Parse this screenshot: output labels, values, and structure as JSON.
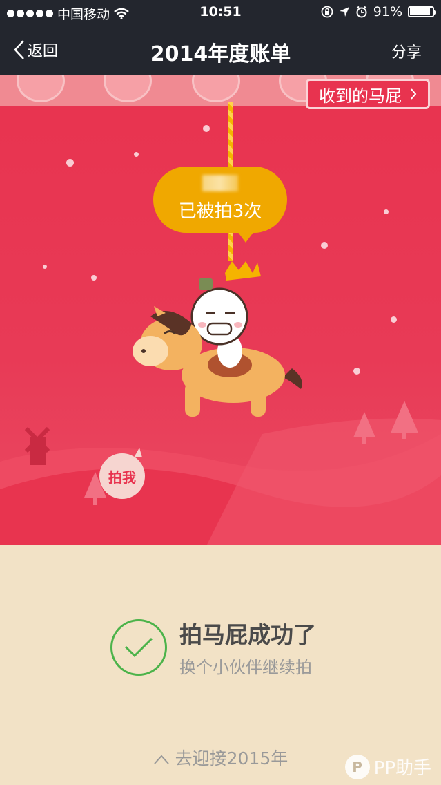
{
  "status_bar": {
    "carrier": "中国移动",
    "time": "10:51",
    "battery_percent": "91%",
    "battery_level": 0.91
  },
  "nav": {
    "back_label": "返回",
    "title": "2014年度账单",
    "share_label": "分享"
  },
  "scene": {
    "received_button": "收到的马屁",
    "patted_count": "已被拍3次",
    "pat_me": "拍我"
  },
  "result": {
    "title": "拍马屁成功了",
    "subtitle": "换个小伙伴继续拍"
  },
  "footer": {
    "next_link": "去迎接2015年"
  },
  "watermark": {
    "logo": "P",
    "text": "PP助手"
  },
  "colors": {
    "nav_bg": "#23262e",
    "scene_red": "#e8334f",
    "bubble_yellow": "#f0a800",
    "success_green": "#4cb34a",
    "bottom_bg": "#f2e2c6"
  }
}
